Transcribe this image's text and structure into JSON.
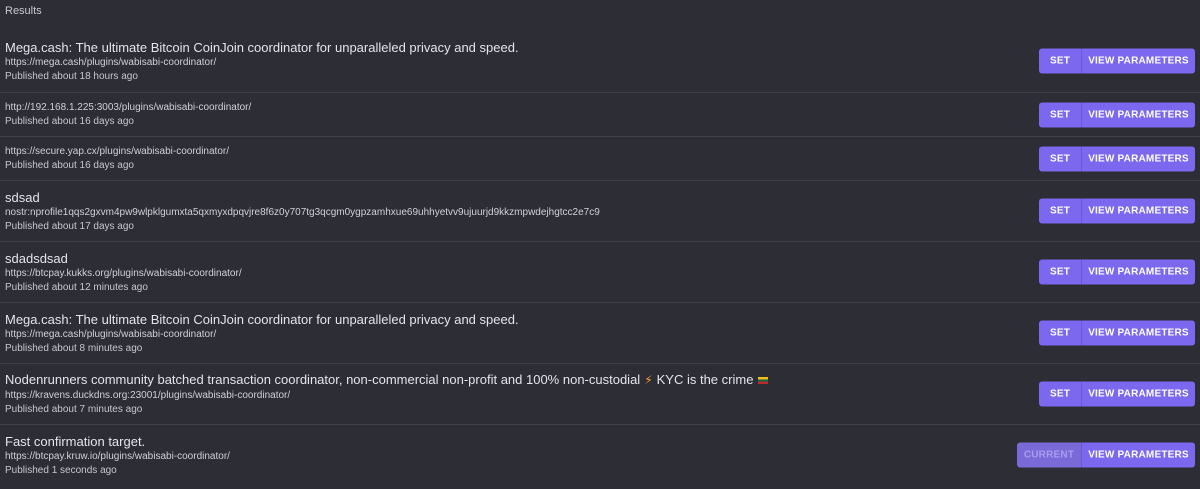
{
  "header": {
    "results_label": "Results"
  },
  "rows": [
    {
      "title": "Mega.cash: The ultimate Bitcoin CoinJoin coordinator for unparalleled privacy and speed.",
      "url": "https://mega.cash/plugins/wabisabi-coordinator/",
      "published": "Published about 18 hours ago",
      "primary_label": "SET",
      "secondary_label": "VIEW PARAMETERS"
    },
    {
      "title": "",
      "url": "http://192.168.1.225:3003/plugins/wabisabi-coordinator/",
      "published": "Published about 16 days ago",
      "primary_label": "SET",
      "secondary_label": "VIEW PARAMETERS"
    },
    {
      "title": "",
      "url": "https://secure.yap.cx/plugins/wabisabi-coordinator/",
      "published": "Published about 16 days ago",
      "primary_label": "SET",
      "secondary_label": "VIEW PARAMETERS"
    },
    {
      "title": "sdsad",
      "url": "nostr:nprofile1qqs2gxvm4pw9wlpklgumxta5qxmyxdpqvjre8f6z0y707tg3qcgm0ygpzamhxue69uhhyetvv9ujuurjd9kkzmpwdejhgtcc2e7c9",
      "published": "Published about 17 days ago",
      "primary_label": "SET",
      "secondary_label": "VIEW PARAMETERS"
    },
    {
      "title": "sdadsdsad",
      "url": "https://btcpay.kukks.org/plugins/wabisabi-coordinator/",
      "published": "Published about 12 minutes ago",
      "primary_label": "SET",
      "secondary_label": "VIEW PARAMETERS"
    },
    {
      "title": "Mega.cash: The ultimate Bitcoin CoinJoin coordinator for unparalleled privacy and speed.",
      "url": "https://mega.cash/plugins/wabisabi-coordinator/",
      "published": "Published about 8 minutes ago",
      "primary_label": "SET",
      "secondary_label": "VIEW PARAMETERS"
    },
    {
      "title": "Nodenrunners community batched transaction coordinator, non-commercial non-profit and 100% non-custodial",
      "title_suffix": "KYC is the crime",
      "url": "https://kravens.duckdns.org:23001/plugins/wabisabi-coordinator/",
      "published": "Published about 7 minutes ago",
      "primary_label": "SET",
      "secondary_label": "VIEW PARAMETERS"
    },
    {
      "title": "Fast confirmation target.",
      "url": "https://btcpay.kruw.io/plugins/wabisabi-coordinator/",
      "published": "Published 1 seconds ago",
      "primary_label": "CURRENT",
      "secondary_label": "VIEW PARAMETERS"
    }
  ],
  "icons": {
    "bolt": "lightning-bolt-icon",
    "flag": "flag-icon"
  },
  "colors": {
    "background": "#2d2d36",
    "accent": "#7b68ee",
    "divider": "#3f3f4a"
  }
}
